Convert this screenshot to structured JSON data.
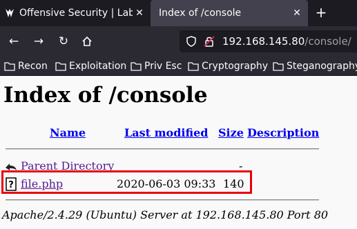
{
  "browser": {
    "tabs": [
      {
        "title": "Offensive Security | Labs |",
        "close": "✕",
        "favicon": "offsec-logo-icon"
      },
      {
        "title": "Index of /console",
        "close": "✕"
      }
    ],
    "new_tab": "+",
    "nav": {
      "back": "←",
      "forward": "→",
      "reload": "↻",
      "home": "home-icon"
    },
    "url": {
      "host": "192.168.145.80",
      "path": "/console/"
    },
    "bookmarks": [
      {
        "label": "Recon"
      },
      {
        "label": "Exploitation"
      },
      {
        "label": "Priv Esc"
      },
      {
        "label": "Cryptography"
      },
      {
        "label": "Steganography"
      }
    ]
  },
  "page": {
    "heading": "Index of /console",
    "columns": {
      "name": "Name",
      "last_modified": "Last modified",
      "size": "Size",
      "description": "Description"
    },
    "rows": [
      {
        "name": "Parent Directory",
        "date": "",
        "size": "-",
        "icon": "back-arrow-icon"
      },
      {
        "name": "file.php",
        "date": "2020-06-03 09:33",
        "size": "140",
        "icon": "unknown-file-icon"
      }
    ],
    "footer": "Apache/2.4.29 (Ubuntu) Server at 192.168.145.80 Port 80"
  },
  "colors": {
    "highlight": "#e8000e",
    "link": "#0000ee",
    "visited": "#551a8b"
  }
}
